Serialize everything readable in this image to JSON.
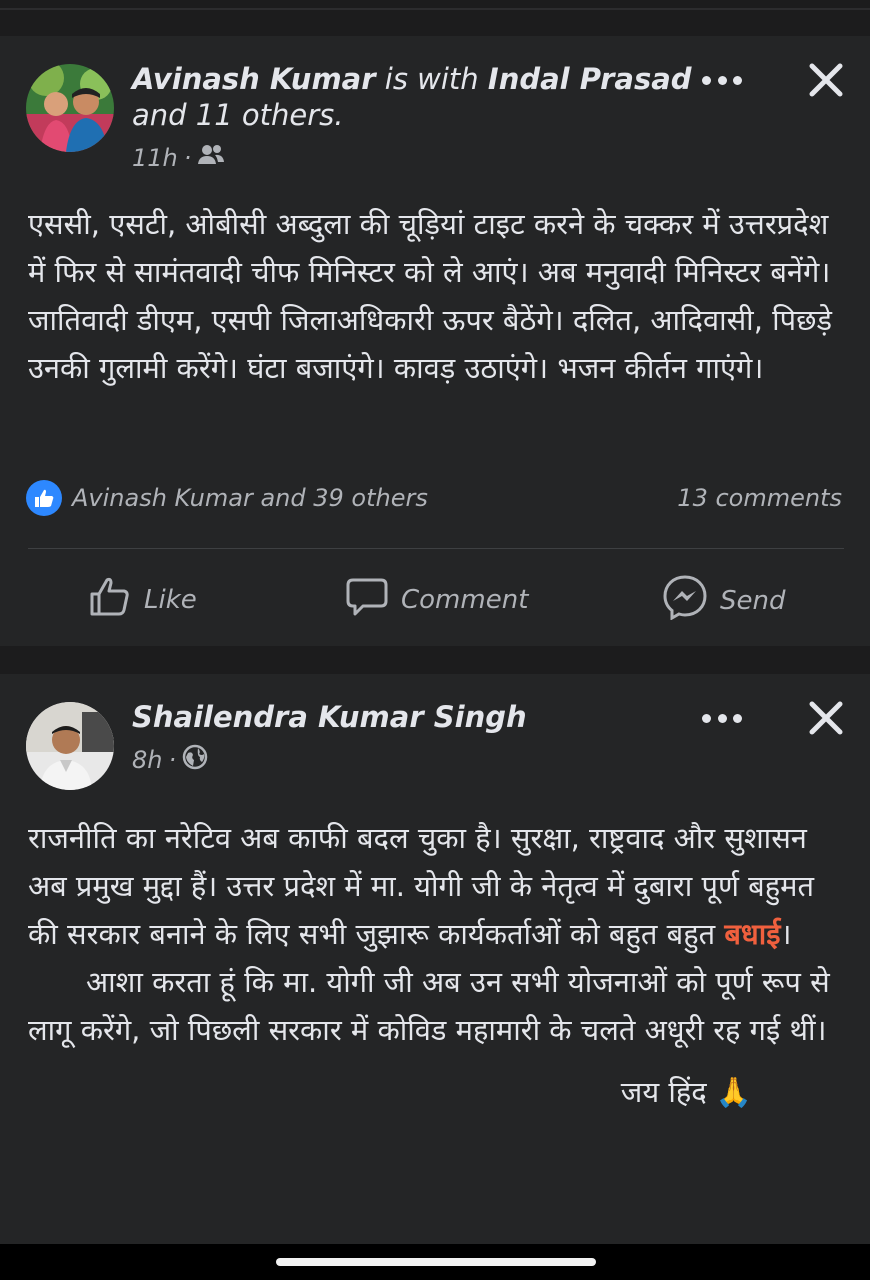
{
  "post1": {
    "author": "Avinash Kumar",
    "with_word": "is with",
    "tagged": "Indal Prasad",
    "and_others": "and 11 others.",
    "time": "11h",
    "audience_icon": "friends-icon",
    "body": "एससी, एसटी, ओबीसी अब्दुला की चूड़ियां टाइट करने के चक्कर में उत्तरप्रदेश में फिर से सामंतवादी चीफ मिनिस्टर को ले आएं। अब मनुवादी मिनिस्टर बनेंगे। जातिवादी डीएम, एसपी जिलाअधिकारी ऊपर बैठेंगे। दलित, आदिवासी, पिछड़े उनकी गुलामी करेंगे। घंटा बजाएंगे। कावड़ उठाएंगे। भजन कीर्तन गाएंगे।",
    "reactions": "Avinash Kumar and 39 others",
    "comments": "13 comments"
  },
  "actions": {
    "like": "Like",
    "comment": "Comment",
    "send": "Send"
  },
  "post2": {
    "author": "Shailendra Kumar Singh",
    "time": "8h",
    "audience_icon": "globe-icon",
    "para1_before": "राजनीति का नरेटिव अब काफी बदल चुका है। सुरक्षा, राष्ट्रवाद और सुशासन अब प्रमुख मुद्दा हैं। उत्तर प्रदेश में मा. योगी जी के नेतृत्व में दुबारा पूर्ण बहुमत की सरकार बनाने के लिए सभी जुझारू कार्यकर्ताओं को बहुत बहुत ",
    "para1_highlight": "बधाई",
    "para1_after": "।",
    "para2": "आशा करता हूं कि मा. योगी जी अब उन सभी योजनाओं को पूर्ण रूप से लागू करेंगे, जो पिछली सरकार में कोविड महामारी के चलते अधूरी रह गई थीं।",
    "signoff": "जय हिंद",
    "signoff_emoji": "🙏"
  },
  "colors": {
    "accent_blue": "#2d88ff",
    "highlight": "#f0603e",
    "card_bg": "#242526"
  }
}
